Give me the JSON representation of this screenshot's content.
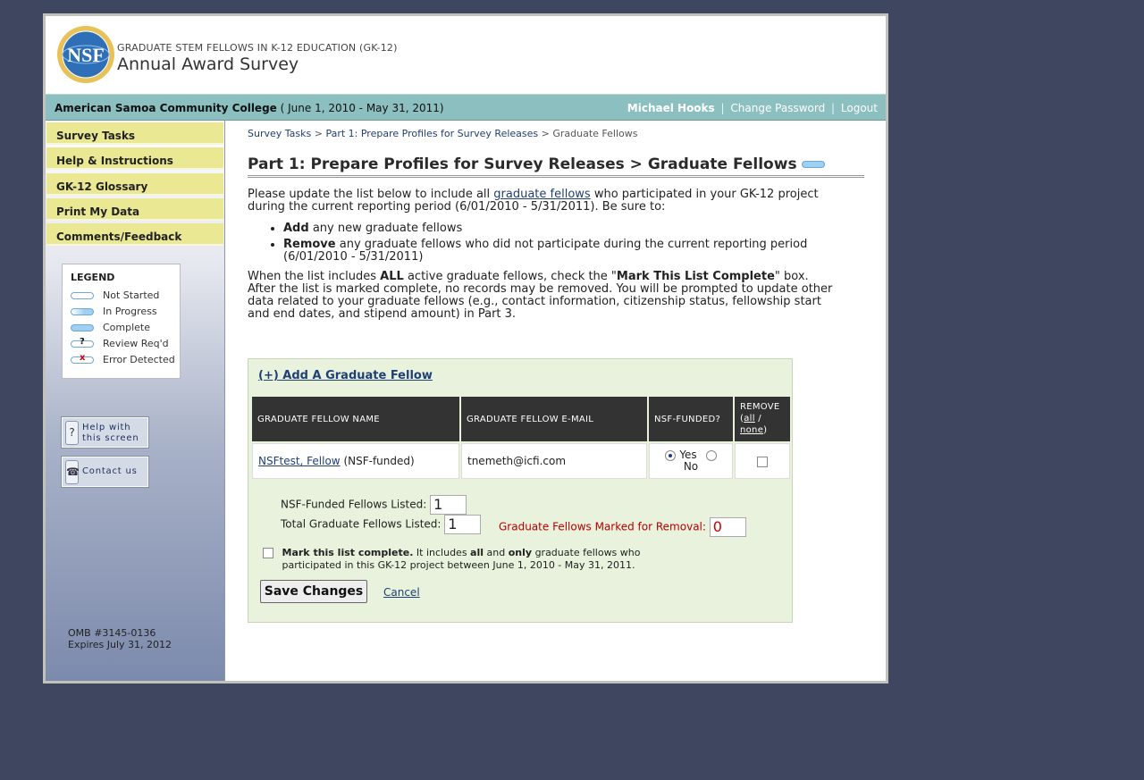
{
  "header": {
    "logo_text": "NSF",
    "subtitle": "GRADUATE STEM FELLOWS IN K-12 EDUCATION (GK-12)",
    "title": "Annual Award Survey"
  },
  "topbar": {
    "college": "American Samoa Community College",
    "period": "( June 1, 2010 - May 31, 2011)",
    "user": "Michael Hooks",
    "change_password": "Change Password",
    "logout": "Logout",
    "separator": "|"
  },
  "sidebar": {
    "items": [
      {
        "label": "Survey Tasks"
      },
      {
        "label": "Help & Instructions"
      },
      {
        "label": "GK-12 Glossary"
      },
      {
        "label": "Print My Data"
      },
      {
        "label": "Comments/Feedback"
      }
    ],
    "legend": {
      "title": "LEGEND",
      "items": [
        {
          "label": "Not Started"
        },
        {
          "label": "In Progress"
        },
        {
          "label": "Complete"
        },
        {
          "label": "Review Req'd",
          "mark": "?"
        },
        {
          "label": "Error Detected",
          "mark": "x"
        }
      ]
    },
    "help_button": {
      "line1": "Help with",
      "line2": "this screen"
    },
    "contact_button": {
      "label": "Contact us"
    },
    "omb": {
      "line1": "OMB #3145-0136",
      "line2": "Expires July 31, 2012"
    }
  },
  "breadcrumb": {
    "item1": "Survey Tasks",
    "sep": ">",
    "item2": "Part 1: Prepare Profiles for Survey Releases",
    "current": "Graduate Fellows"
  },
  "page": {
    "title": "Part 1: Prepare Profiles for Survey Releases > Graduate Fellows",
    "intro_before": "Please update the list below to include all",
    "intro_link": "graduate fellows",
    "intro_after": "who participated in your GK-12 project during the current reporting period (6/01/2010 - 5/31/2011). Be sure to:",
    "bullet1_bold": "Add",
    "bullet1_rest": "any new graduate fellows",
    "bullet2_bold": "Remove",
    "bullet2_rest": "any graduate fellows who did not participate during the current reporting period (6/01/2010 - 5/31/2011)",
    "para2_a": "When the list includes",
    "para2_b": "ALL",
    "para2_c": "active graduate fellows, check the \"",
    "para2_d": "Mark This List Complete",
    "para2_e": "\" box. After the list is marked complete, no records may be removed. You will be prompted to update other data related to your graduate fellows (e.g., contact information, citizenship status, fellowship start and end dates, and stipend amount) in Part 3."
  },
  "panel": {
    "add_link": "(+) Add A Graduate Fellow",
    "columns": {
      "name": "GRADUATE FELLOW NAME",
      "email": "GRADUATE FELLOW E-MAIL",
      "funded": "NSF-FUNDED?",
      "remove": "REMOVE",
      "remove_all": "all",
      "remove_slash": "/",
      "remove_none": "none",
      "open_paren": "(",
      "close_paren": ")"
    },
    "rows": [
      {
        "name": "NSFtest, Fellow",
        "note": "(NSF-funded)",
        "email": "tnemeth@icfi.com",
        "yes": "Yes",
        "no": "No"
      }
    ],
    "nsf_listed_label": "NSF-Funded Fellows Listed:",
    "nsf_listed_value": "1",
    "total_listed_label": "Total Graduate Fellows Listed:",
    "total_listed_value": "1",
    "removal_label": "Graduate Fellows Marked for Removal:",
    "removal_value": "0",
    "mark_bold": "Mark this list complete.",
    "mark_a": "It includes",
    "mark_all": "all",
    "mark_and": "and",
    "mark_only": "only",
    "mark_b": "graduate fellows who",
    "mark_c": "participated in this GK-12 project between June 1, 2010 - May 31, 2011.",
    "save": "Save Changes",
    "cancel": "Cancel"
  },
  "colors": {
    "background": "#3f4760",
    "topbar": "#8cbfbf",
    "nav": "#ebe894",
    "panel": "#e8f2dc"
  }
}
